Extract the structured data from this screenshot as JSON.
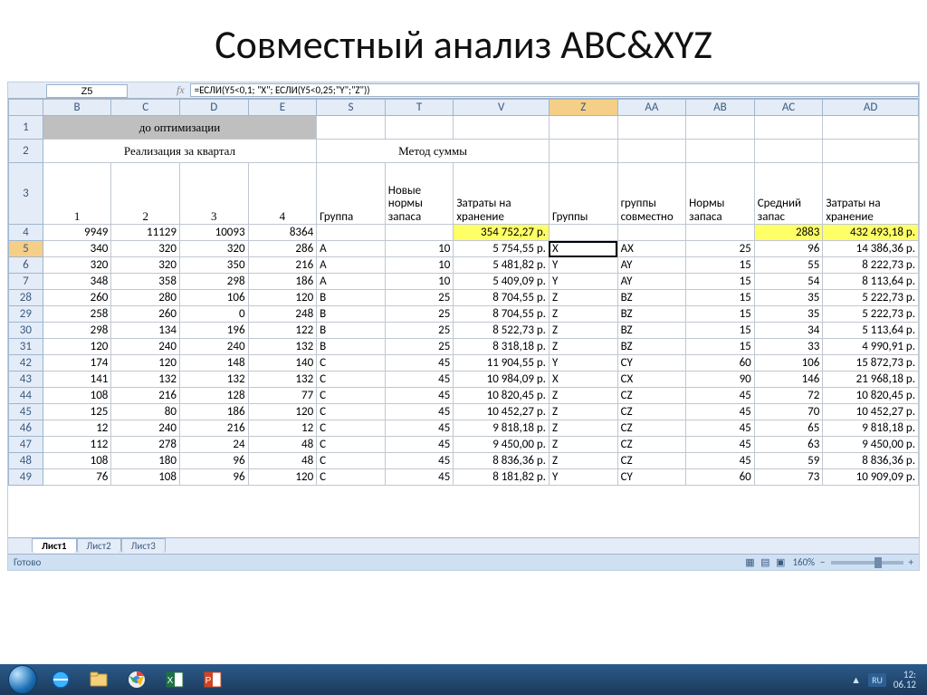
{
  "slide_title": "Совместный анализ ABC&XYZ",
  "namebox": "Z5",
  "fx_label": "fx",
  "formula": "=ЕСЛИ(Y5<0,1; \"X\"; ЕСЛИ(Y5<0,25;\"Y\";\"Z\"))",
  "col_headers": [
    "B",
    "C",
    "D",
    "E",
    "S",
    "T",
    "V",
    "Z",
    "AA",
    "AB",
    "AC",
    "AD"
  ],
  "row1_text": "до оптимизации",
  "row2_left": "Реализация за квартал",
  "row2_right": "Метод суммы",
  "row3": {
    "q1": "1",
    "q2": "2",
    "q3": "3",
    "q4": "4",
    "group": "Группа",
    "norms": "Новые нормы запаса",
    "costs": "Затраты на хранение",
    "groups": "Группы",
    "joint": "группы совместно",
    "norms2": "Нормы запаса",
    "avg": "Средний запас",
    "costs2": "Затраты на хранение"
  },
  "rows": [
    {
      "n": "4",
      "b": "9949",
      "c": "11129",
      "d": "10093",
      "e": "8364",
      "s": "",
      "t": "",
      "v": "354 752,27 р.",
      "z": "",
      "aa": "",
      "ab": "",
      "ac": "2883",
      "ad": "432 493,18 р.",
      "hiV": true,
      "hiAC": true,
      "hiAD": true
    },
    {
      "n": "5",
      "b": "340",
      "c": "320",
      "d": "320",
      "e": "286",
      "s": "A",
      "t": "10",
      "v": "5 754,55 р.",
      "z": "X",
      "aa": "AX",
      "ab": "25",
      "ac": "96",
      "ad": "14 386,36 р.",
      "sel": true
    },
    {
      "n": "6",
      "b": "320",
      "c": "320",
      "d": "350",
      "e": "216",
      "s": "A",
      "t": "10",
      "v": "5 481,82 р.",
      "z": "Y",
      "aa": "AY",
      "ab": "15",
      "ac": "55",
      "ad": "8 222,73 р."
    },
    {
      "n": "7",
      "b": "348",
      "c": "358",
      "d": "298",
      "e": "186",
      "s": "A",
      "t": "10",
      "v": "5 409,09 р.",
      "z": "Y",
      "aa": "AY",
      "ab": "15",
      "ac": "54",
      "ad": "8 113,64 р."
    },
    {
      "n": "28",
      "b": "260",
      "c": "280",
      "d": "106",
      "e": "120",
      "s": "B",
      "t": "25",
      "v": "8 704,55 р.",
      "z": "Z",
      "aa": "BZ",
      "ab": "15",
      "ac": "35",
      "ad": "5 222,73 р."
    },
    {
      "n": "29",
      "b": "258",
      "c": "260",
      "d": "0",
      "e": "248",
      "s": "B",
      "t": "25",
      "v": "8 704,55 р.",
      "z": "Z",
      "aa": "BZ",
      "ab": "15",
      "ac": "35",
      "ad": "5 222,73 р."
    },
    {
      "n": "30",
      "b": "298",
      "c": "134",
      "d": "196",
      "e": "122",
      "s": "B",
      "t": "25",
      "v": "8 522,73 р.",
      "z": "Z",
      "aa": "BZ",
      "ab": "15",
      "ac": "34",
      "ad": "5 113,64 р."
    },
    {
      "n": "31",
      "b": "120",
      "c": "240",
      "d": "240",
      "e": "132",
      "s": "B",
      "t": "25",
      "v": "8 318,18 р.",
      "z": "Z",
      "aa": "BZ",
      "ab": "15",
      "ac": "33",
      "ad": "4 990,91 р."
    },
    {
      "n": "42",
      "b": "174",
      "c": "120",
      "d": "148",
      "e": "140",
      "s": "C",
      "t": "45",
      "v": "11 904,55 р.",
      "z": "Y",
      "aa": "CY",
      "ab": "60",
      "ac": "106",
      "ad": "15 872,73 р."
    },
    {
      "n": "43",
      "b": "141",
      "c": "132",
      "d": "132",
      "e": "132",
      "s": "C",
      "t": "45",
      "v": "10 984,09 р.",
      "z": "X",
      "aa": "CX",
      "ab": "90",
      "ac": "146",
      "ad": "21 968,18 р."
    },
    {
      "n": "44",
      "b": "108",
      "c": "216",
      "d": "128",
      "e": "77",
      "s": "C",
      "t": "45",
      "v": "10 820,45 р.",
      "z": "Z",
      "aa": "CZ",
      "ab": "45",
      "ac": "72",
      "ad": "10 820,45 р."
    },
    {
      "n": "45",
      "b": "125",
      "c": "80",
      "d": "186",
      "e": "120",
      "s": "C",
      "t": "45",
      "v": "10 452,27 р.",
      "z": "Z",
      "aa": "CZ",
      "ab": "45",
      "ac": "70",
      "ad": "10 452,27 р."
    },
    {
      "n": "46",
      "b": "12",
      "c": "240",
      "d": "216",
      "e": "12",
      "s": "C",
      "t": "45",
      "v": "9 818,18 р.",
      "z": "Z",
      "aa": "CZ",
      "ab": "45",
      "ac": "65",
      "ad": "9 818,18 р."
    },
    {
      "n": "47",
      "b": "112",
      "c": "278",
      "d": "24",
      "e": "48",
      "s": "C",
      "t": "45",
      "v": "9 450,00 р.",
      "z": "Z",
      "aa": "CZ",
      "ab": "45",
      "ac": "63",
      "ad": "9 450,00 р."
    },
    {
      "n": "48",
      "b": "108",
      "c": "180",
      "d": "96",
      "e": "48",
      "s": "C",
      "t": "45",
      "v": "8 836,36 р.",
      "z": "Z",
      "aa": "CZ",
      "ab": "45",
      "ac": "59",
      "ad": "8 836,36 р."
    },
    {
      "n": "49",
      "b": "76",
      "c": "108",
      "d": "96",
      "e": "120",
      "s": "C",
      "t": "45",
      "v": "8 181,82 р.",
      "z": "Y",
      "aa": "CY",
      "ab": "60",
      "ac": "73",
      "ad": "10 909,09 р.",
      "partial": true
    }
  ],
  "tabs": [
    "Лист1",
    "Лист2",
    "Лист3"
  ],
  "status_left": "Готово",
  "zoom": "160%",
  "lang": "RU",
  "time": "12:",
  "date": "06.12"
}
